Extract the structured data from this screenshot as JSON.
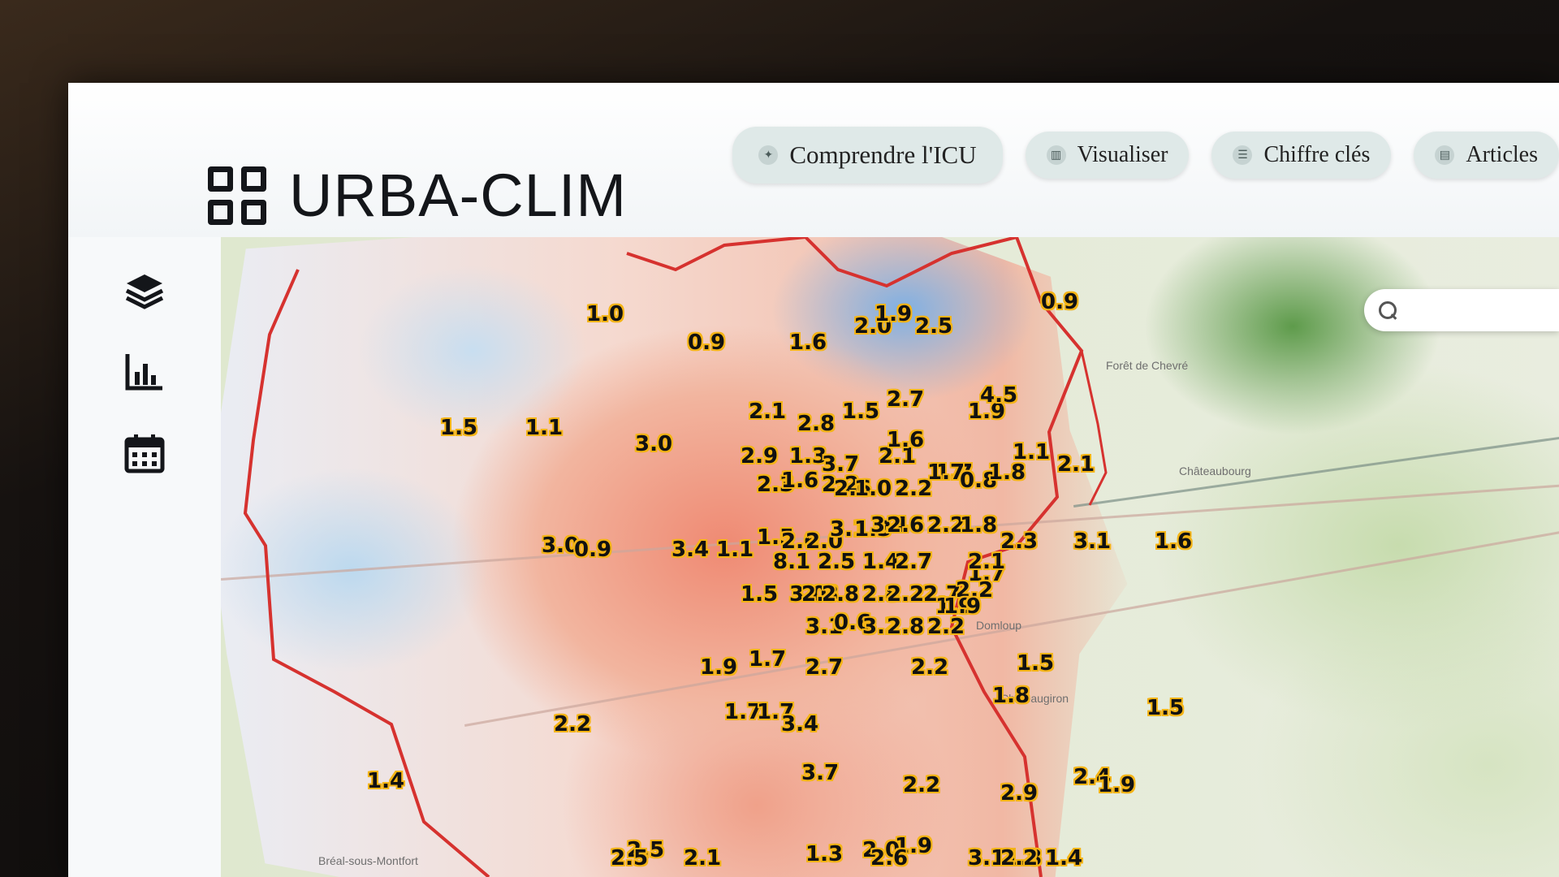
{
  "app": {
    "title": "URBA-CLIM"
  },
  "nav": [
    {
      "label": "Comprendre l'ICU",
      "icon": "lightbulb-icon"
    },
    {
      "label": "Visualiser",
      "icon": "map-icon"
    },
    {
      "label": "Chiffre clés",
      "icon": "list-icon"
    },
    {
      "label": "Articles",
      "icon": "document-icon"
    }
  ],
  "sidebar": [
    {
      "icon": "layers-icon"
    },
    {
      "icon": "bar-chart-icon"
    },
    {
      "icon": "calendar-icon"
    }
  ],
  "map": {
    "town_labels": [
      "Bréal-sous-Montfort",
      "Domloup",
      "Châteaugiron",
      "Forêt de Chevré",
      "Châteaubourg"
    ],
    "values": [
      "1.0",
      "0.9",
      "1.6",
      "2.0",
      "1.9",
      "2.5",
      "0.9",
      "2.1",
      "2.8",
      "1.5",
      "2.7",
      "1.9",
      "4.5",
      "1.5",
      "1.1",
      "3.0",
      "2.9",
      "1.3",
      "3.7",
      "2.1",
      "1.7",
      "1.1",
      "2.1",
      "1.6",
      "2.3",
      "1.6",
      "2.2",
      "2.6",
      "1.0",
      "2.2",
      "1.7",
      "0.8",
      "1.8",
      "3.1",
      "1.6",
      "3.0",
      "0.9",
      "3.4",
      "1.1",
      "1.5",
      "2.6",
      "2.0",
      "3.1",
      "1.3",
      "3.4",
      "2.6",
      "2.2",
      "1.8",
      "2.3",
      "8.1",
      "2.5",
      "1.4",
      "2.7",
      "1.7",
      "1.5",
      "3.0",
      "2.3",
      "2.8",
      "2.8",
      "2.2",
      "2.7",
      "2.2",
      "2.1",
      "1.9",
      "3.1",
      "0.6",
      "3.2",
      "2.8",
      "2.2",
      "1.9",
      "1.7",
      "1.5",
      "1.9",
      "2.7",
      "2.2",
      "1.7",
      "1.7",
      "3.4",
      "1.8",
      "1.5",
      "2.2",
      "1.4",
      "3.7",
      "2.2",
      "2.9",
      "2.4",
      "1.9",
      "2.5",
      "1.3",
      "2.0",
      "1.9",
      "1.8",
      "2.6",
      "2.5",
      "2.1",
      "3.1",
      "2.2",
      "1.4"
    ]
  }
}
